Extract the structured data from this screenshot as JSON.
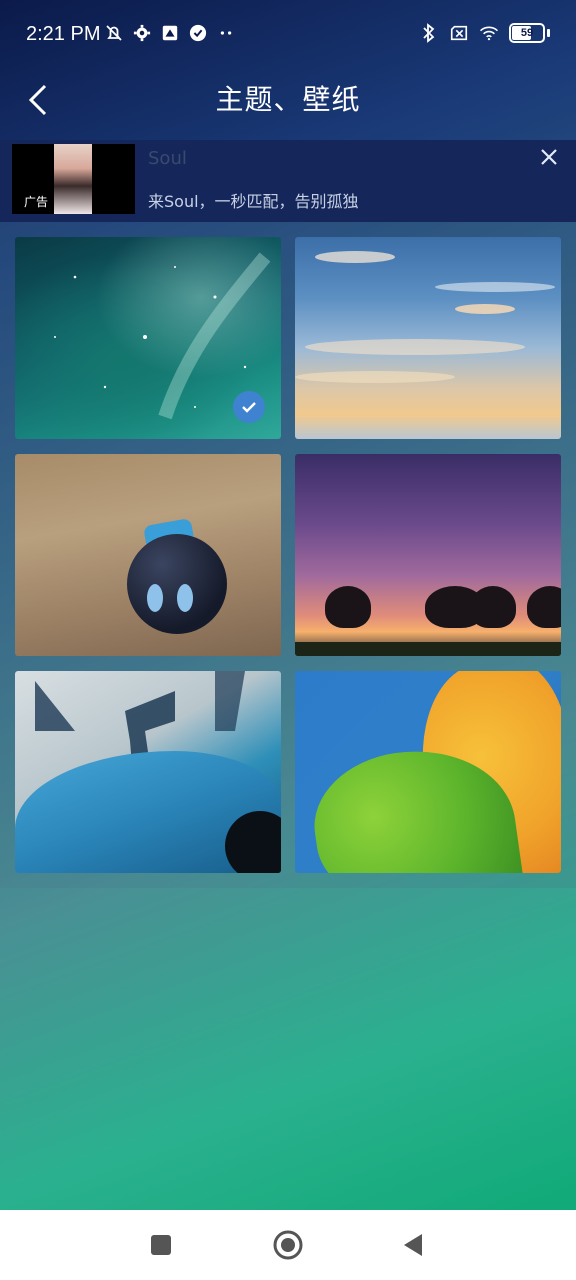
{
  "status_bar": {
    "time": "2:21 PM",
    "battery_level": "59",
    "icons": [
      "mute-icon",
      "settings-icon",
      "app-icon",
      "check-circle-icon",
      "more-dots-icon",
      "bluetooth-icon",
      "sim-off-icon",
      "wifi-icon",
      "battery-icon"
    ]
  },
  "header": {
    "title": "主题、壁纸",
    "back_icon": "chevron-left-icon"
  },
  "ad": {
    "name": "Soul",
    "description": "来Soul，一秒匹配，告别孤独",
    "thumbnail_badge": "广告",
    "close_icon": "close-icon"
  },
  "wallpapers": [
    {
      "name": "space-nebula",
      "selected": true
    },
    {
      "name": "sky-clouds",
      "selected": false
    },
    {
      "name": "bomb-toy",
      "selected": false
    },
    {
      "name": "sunset-trees",
      "selected": false
    },
    {
      "name": "blue-car",
      "selected": false
    },
    {
      "name": "green-yellow-leaves",
      "selected": false
    }
  ],
  "navigation_bar": {
    "buttons": [
      "square-recents-icon",
      "circle-home-icon",
      "triangle-back-icon"
    ]
  },
  "colors": {
    "accent_check": "#3f82d0",
    "ad_background": "#15275a"
  }
}
